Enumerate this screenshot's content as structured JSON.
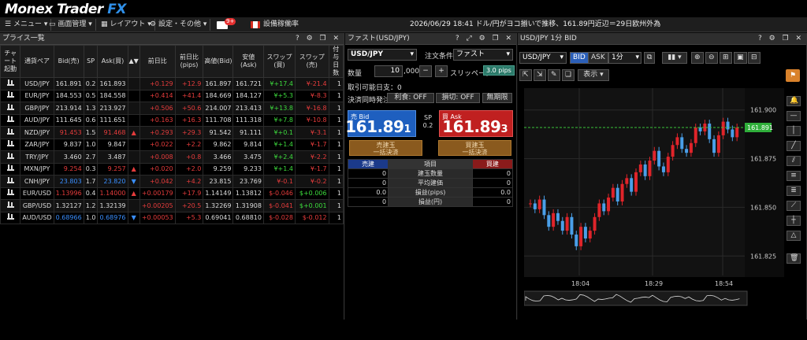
{
  "app": {
    "logo_main": "Monex Trader",
    "logo_fx": "FX"
  },
  "menu": {
    "menu": "メニュー",
    "screen": "画面管理",
    "layout": "レイアウト",
    "settings": "設定・その他",
    "mail_badge": "9+",
    "capacity": "設備稼働率"
  },
  "ticker": "2026/06/29 18:41 ドル/円がヨコ揃いで推移、161.89円近辺＝29日欧州外為",
  "price_list": {
    "title": "プライス一覧",
    "headers": [
      "チャート起動",
      "通貨ペア",
      "Bid(売)",
      "SP",
      "Ask(買)",
      "▲▼",
      "前日比",
      "前日比(pips)",
      "高値(Bid)",
      "安値(Ask)",
      "スワップ(買)",
      "スワップ(売)",
      "付与日数"
    ],
    "rows": [
      [
        "USD/JPY",
        "161.891",
        "0.2",
        "161.893",
        "",
        "+0.129",
        "+12.9",
        "161.897",
        "161.721",
        "¥+17.4",
        "¥-21.4",
        "1"
      ],
      [
        "EUR/JPY",
        "184.553",
        "0.5",
        "184.558",
        "",
        "+0.414",
        "+41.4",
        "184.669",
        "184.127",
        "¥+5.3",
        "¥-8.3",
        "1"
      ],
      [
        "GBP/JPY",
        "213.914",
        "1.3",
        "213.927",
        "",
        "+0.506",
        "+50.6",
        "214.007",
        "213.413",
        "¥+13.8",
        "¥-16.8",
        "1"
      ],
      [
        "AUD/JPY",
        "111.645",
        "0.6",
        "111.651",
        "",
        "+0.163",
        "+16.3",
        "111.708",
        "111.318",
        "¥+7.8",
        "¥-10.8",
        "1"
      ],
      [
        "NZD/JPY",
        "91.453",
        "1.5",
        "91.468",
        "up",
        "+0.293",
        "+29.3",
        "91.542",
        "91.111",
        "¥+0.1",
        "¥-3.1",
        "1"
      ],
      [
        "ZAR/JPY",
        "9.837",
        "1.0",
        "9.847",
        "",
        "+0.022",
        "+2.2",
        "9.862",
        "9.814",
        "¥+1.4",
        "¥-1.7",
        "1"
      ],
      [
        "TRY/JPY",
        "3.460",
        "2.7",
        "3.487",
        "",
        "+0.008",
        "+0.8",
        "3.466",
        "3.475",
        "¥+2.4",
        "¥-2.2",
        "1"
      ],
      [
        "MXN/JPY",
        "9.254",
        "0.3",
        "9.257",
        "up",
        "+0.020",
        "+2.0",
        "9.259",
        "9.233",
        "¥+1.4",
        "¥-1.7",
        "1"
      ],
      [
        "CNH/JPY",
        "23.803",
        "1.7",
        "23.820",
        "down",
        "+0.042",
        "+4.2",
        "23.815",
        "23.769",
        "¥-0.1",
        "¥-0.2",
        "1"
      ],
      [
        "EUR/USD",
        "1.13996",
        "0.4",
        "1.14000",
        "up",
        "+0.00179",
        "+17.9",
        "1.14149",
        "1.13812",
        "$-0.046",
        "$+0.006",
        "1"
      ],
      [
        "GBP/USD",
        "1.32127",
        "1.2",
        "1.32139",
        "",
        "+0.00205",
        "+20.5",
        "1.32269",
        "1.31908",
        "$-0.041",
        "$+0.001",
        "1"
      ],
      [
        "AUD/USD",
        "0.68966",
        "1.0",
        "0.68976",
        "down",
        "+0.00053",
        "+5.3",
        "0.69041",
        "0.68810",
        "$-0.028",
        "$-0.012",
        "1"
      ]
    ]
  },
  "order": {
    "title": "ファスト(USD/JPY)",
    "pair": "USD/JPY",
    "cond_label": "注文条件",
    "cond": "ファスト",
    "qty_label": "数量",
    "qty": "10",
    "qty_unit": ",000",
    "slip_label": "スリッページ",
    "slip": "3.0 pips",
    "tradable": "取引可能日支：0",
    "settle_label": "決済同時発注",
    "profit": "利食: OFF",
    "loss": "損切: OFF",
    "unlimited": "無期限",
    "bid_label": "売 Bid",
    "bid_main": "161.89",
    "bid_small": "1",
    "sp_label": "SP",
    "sp": "0.2",
    "ask_label": "買 Ask",
    "ask_main": "161.89",
    "ask_small": "3",
    "sell_settle": "売建玉\n一括決済",
    "buy_settle": "買建玉\n一括決済",
    "pos_sell": "売建",
    "pos_item": "項目",
    "pos_buy": "買建",
    "pos_rows": [
      [
        "0",
        "建玉数量",
        "0"
      ],
      [
        "0",
        "平均建価",
        "0"
      ],
      [
        "0.0",
        "損益(pips)",
        "0.0"
      ],
      [
        "0",
        "損益(円)",
        "0"
      ]
    ]
  },
  "chart": {
    "title": "USD/JPY 1分 BID",
    "pair": "USD/JPY",
    "bid": "BID",
    "ask": "ASK",
    "interval": "1分",
    "display": "表示",
    "last": "161.891",
    "yticks": [
      "161.900",
      "161.875",
      "161.850",
      "161.825"
    ],
    "xticks": [
      "18:04",
      "18:29",
      "18:54"
    ]
  },
  "chart_data": {
    "type": "candlestick",
    "x_labels": [
      "18:04",
      "18:29",
      "18:54"
    ],
    "ylim": [
      161.815,
      161.91
    ],
    "current": 161.891
  }
}
